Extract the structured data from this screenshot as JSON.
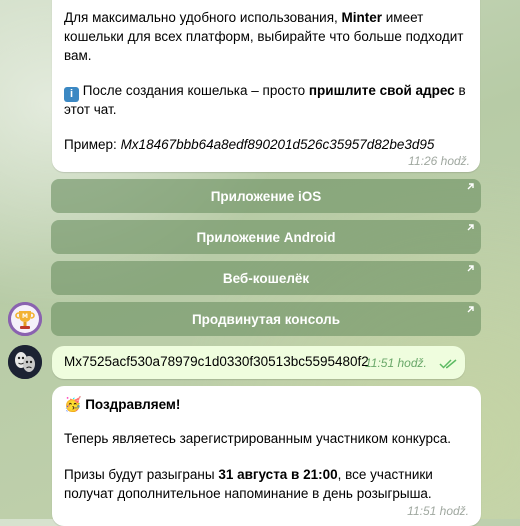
{
  "message1": {
    "line1_pre": "Для максимально удобного использования, ",
    "line1_bold": "Minter",
    "line1_post": " имеет",
    "line2": "кошельки для всех платформ, выбирайте что больше подходит",
    "line3": "вам.",
    "info_emoji": "ℹ️",
    "line4_pre": " После создания кошелька – просто ",
    "line4_bold": "пришлите свой адрес",
    "line4_post": " в",
    "line5": "этот чат.",
    "example_label": "Пример: ",
    "example_address": "Mx18467bbb64a8edf890201d526c35957d82be3d95",
    "time": "11:26 hodž."
  },
  "buttons": [
    {
      "label": "Приложение iOS"
    },
    {
      "label": "Приложение Android"
    },
    {
      "label": "Веб-кошелёк"
    },
    {
      "label": "Продвинутая консоль"
    }
  ],
  "message2": {
    "text": "Mx7525acf530a78979c1d0330f30513bc5595480f2",
    "time": "11:51 hodž.",
    "status": "read-double-check-icon"
  },
  "message3": {
    "emoji": "🥳",
    "title": "Поздравляем!",
    "line1": "Теперь являетесь зарегистрированным участником конкурса.",
    "line2_pre": "Призы будут разыграны ",
    "line2_bold": "31 августа в 21:00",
    "line2_post": ", все участники",
    "line3": "получат дополнительное напоминание в день розыгрыша.",
    "time": "11:51 hodž."
  },
  "colors": {
    "button_bg": "#6e9164",
    "outgoing_bubble": "#effdde",
    "check_color": "#5dbb63"
  }
}
